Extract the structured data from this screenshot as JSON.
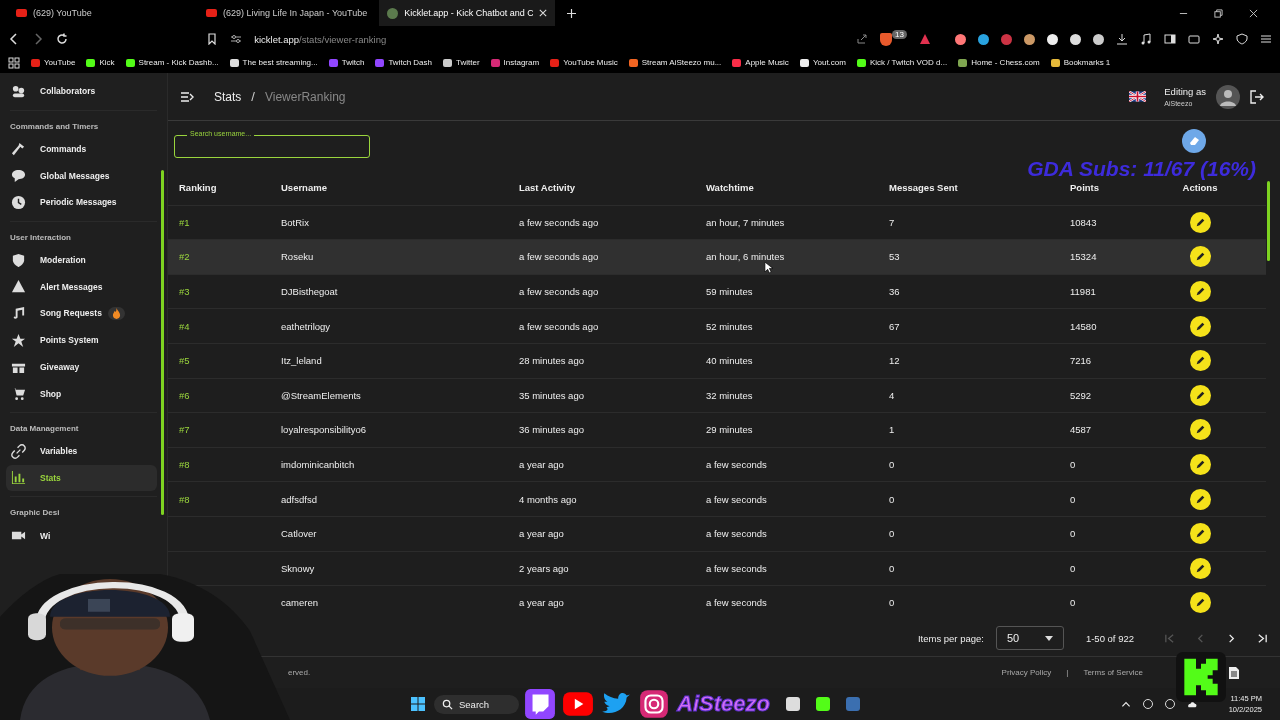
{
  "browser": {
    "tabs": [
      {
        "title": "(629) YouTube",
        "selected": false
      },
      {
        "title": "(629) Living Life In Japan - YouTube",
        "selected": false
      },
      {
        "title": "Kicklet.app - Kick Chatbot and C",
        "selected": true
      }
    ],
    "address": {
      "host": "kicklet.app",
      "path": "/stats/viewer-ranking"
    },
    "shield_count": "13",
    "bookmarks": [
      "YouTube",
      "Kick",
      "Stream - Kick Dashb...",
      "The best streaming...",
      "Twitch",
      "Twitch Dash",
      "Twitter",
      "Instagram",
      "YouTube Music",
      "Stream AiSteezo mu...",
      "Apple Music",
      "Yout.com",
      "Kick / Twitch VOD d...",
      "Home - Chess.com",
      "Bookmarks 1"
    ]
  },
  "sidebar": {
    "sections": [
      {
        "items": [
          {
            "label": "Collaborators",
            "selected": false,
            "hot": false
          }
        ]
      },
      {
        "title": "Commands and Timers",
        "items": [
          {
            "label": "Commands",
            "selected": false,
            "hot": false
          },
          {
            "label": "Global Messages",
            "selected": false,
            "hot": false
          },
          {
            "label": "Periodic Messages",
            "selected": false,
            "hot": false
          }
        ]
      },
      {
        "title": "User Interaction",
        "items": [
          {
            "label": "Moderation",
            "selected": false,
            "hot": false
          },
          {
            "label": "Alert Messages",
            "selected": false,
            "hot": false
          },
          {
            "label": "Song Requests",
            "selected": false,
            "hot": true
          },
          {
            "label": "Points System",
            "selected": false,
            "hot": false
          },
          {
            "label": "Giveaway",
            "selected": false,
            "hot": false
          },
          {
            "label": "Shop",
            "selected": false,
            "hot": false
          }
        ]
      },
      {
        "title": "Data Management",
        "items": [
          {
            "label": "Variables",
            "selected": false,
            "hot": false
          },
          {
            "label": "Stats",
            "selected": true,
            "hot": false
          }
        ]
      },
      {
        "title": "Graphic Desi",
        "items": [
          {
            "label": "Wi",
            "selected": false,
            "hot": false
          }
        ]
      }
    ]
  },
  "header": {
    "breadcrumb": [
      "Stats",
      "ViewerRanking"
    ],
    "separator": "/",
    "editing_label": "Editing as",
    "user": "AiSteezo"
  },
  "search": {
    "placeholder": "Search username..."
  },
  "overlay_text": "GDA Subs: 11/67 (16%)",
  "table": {
    "columns": [
      "Ranking",
      "Username",
      "Last Activity",
      "Watchtime",
      "Messages Sent",
      "Points",
      "Actions"
    ],
    "rows": [
      {
        "ranking": "#1",
        "username": "BotRix",
        "last_activity": "a few seconds ago",
        "watchtime": "an hour, 7 minutes",
        "messages": "7",
        "points": "10843",
        "hovered": false
      },
      {
        "ranking": "#2",
        "username": "Roseku",
        "last_activity": "a few seconds ago",
        "watchtime": "an hour, 6 minutes",
        "messages": "53",
        "points": "15324",
        "hovered": true
      },
      {
        "ranking": "#3",
        "username": "DJBisthegoat",
        "last_activity": "a few seconds ago",
        "watchtime": "59 minutes",
        "messages": "36",
        "points": "11981",
        "hovered": false
      },
      {
        "ranking": "#4",
        "username": "eathetrilogy",
        "last_activity": "a few seconds ago",
        "watchtime": "52 minutes",
        "messages": "67",
        "points": "14580",
        "hovered": false
      },
      {
        "ranking": "#5",
        "username": "Itz_leland",
        "last_activity": "28 minutes ago",
        "watchtime": "40 minutes",
        "messages": "12",
        "points": "7216",
        "hovered": false
      },
      {
        "ranking": "#6",
        "username": "@StreamElements",
        "last_activity": "35 minutes ago",
        "watchtime": "32 minutes",
        "messages": "4",
        "points": "5292",
        "hovered": false
      },
      {
        "ranking": "#7",
        "username": "loyalresponsibilityo6",
        "last_activity": "36 minutes ago",
        "watchtime": "29 minutes",
        "messages": "1",
        "points": "4587",
        "hovered": false
      },
      {
        "ranking": "#8",
        "username": "imdominicanbitch",
        "last_activity": "a year ago",
        "watchtime": "a few seconds",
        "messages": "0",
        "points": "0",
        "hovered": false
      },
      {
        "ranking": "#8",
        "username": "adfsdfsd",
        "last_activity": "4 months ago",
        "watchtime": "a few seconds",
        "messages": "0",
        "points": "0",
        "hovered": false
      },
      {
        "username": "Catlover",
        "last_activity": "a year ago",
        "watchtime": "a few seconds",
        "messages": "0",
        "points": "0",
        "hovered": false
      },
      {
        "username": "Sknowy",
        "last_activity": "2 years ago",
        "watchtime": "a few seconds",
        "messages": "0",
        "points": "0",
        "hovered": false
      },
      {
        "username": "cameren",
        "last_activity": "a year ago",
        "watchtime": "a few seconds",
        "messages": "0",
        "points": "0",
        "hovered": false
      }
    ]
  },
  "pagination": {
    "label": "Items per page:",
    "page_size": "50",
    "range": "1-50 of 922",
    "first_disabled": true,
    "prev_disabled": true,
    "next_disabled": false,
    "last_disabled": false
  },
  "footer": {
    "copyright": "erved.",
    "links": [
      "Privacy Policy",
      "Terms of Service"
    ],
    "separator": "|"
  },
  "taskbar": {
    "search": "Search",
    "overlay_name": "AiSteezo",
    "time": "11:45 PM",
    "date": "10/2/2025"
  }
}
